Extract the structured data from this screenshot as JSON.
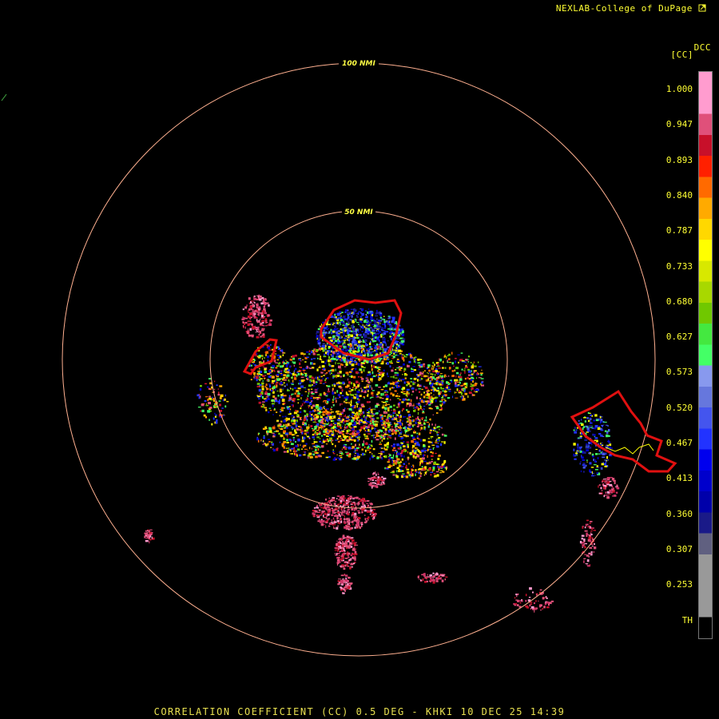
{
  "credit": "NEXLAB-College of DuPage",
  "credit_icon": "external-link-icon",
  "product_code": "DCC",
  "unit": "[CC]",
  "footer": "CORRELATION COEFFICIENT (CC) 0.5 DEG - KHKI 10 DEC 25 14:39",
  "rings": [
    {
      "label": "100 NMI"
    },
    {
      "label": "50 NMI"
    }
  ],
  "colorbar": {
    "ticks": [
      "1.000",
      "0.947",
      "0.893",
      "0.840",
      "0.787",
      "0.733",
      "0.680",
      "0.627",
      "0.573",
      "0.520",
      "0.467",
      "0.413",
      "0.360",
      "0.307",
      "0.253",
      "TH"
    ],
    "colors": [
      "#ff9ccf",
      "#ff9ccf",
      "#e0507a",
      "#c8102a",
      "#ff2000",
      "#ff6a00",
      "#ffaa00",
      "#ffd800",
      "#ffff00",
      "#d8e800",
      "#a8d800",
      "#70c800",
      "#44e840",
      "#44ff66",
      "#8899ee",
      "#6677dd",
      "#4455ee",
      "#2233ff",
      "#0000ee",
      "#0000cc",
      "#0000aa",
      "#1a1a88",
      "#606080",
      "#999999",
      "#999999",
      "#999999",
      "#000000"
    ]
  },
  "colors": {
    "range_ring": "#ffb090",
    "warning_outline": "#e01010",
    "county_line": "#ffff00",
    "label": "#ffff33"
  }
}
